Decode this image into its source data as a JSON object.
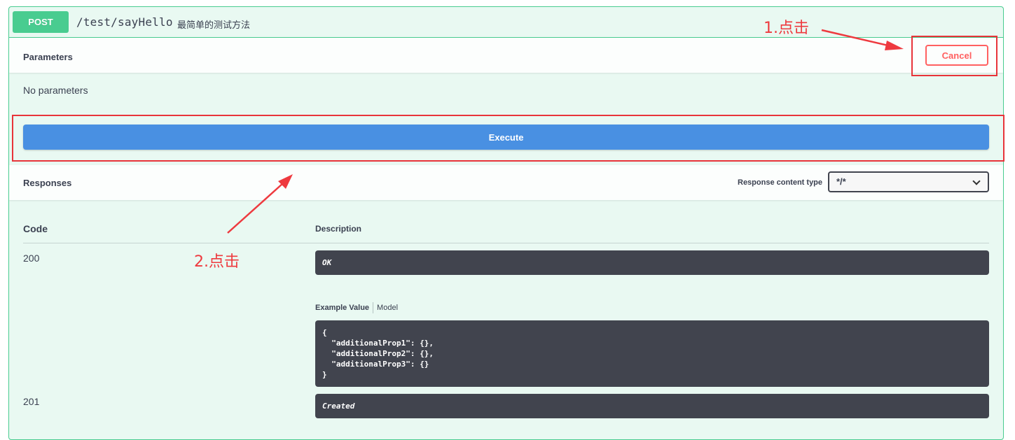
{
  "operation": {
    "method": "POST",
    "path": "/test/sayHello",
    "summary": "最简单的测试方法"
  },
  "parameters": {
    "title": "Parameters",
    "cancel_label": "Cancel",
    "empty_text": "No parameters"
  },
  "execute": {
    "label": "Execute"
  },
  "responses": {
    "title": "Responses",
    "content_type_label": "Response content type",
    "content_type_value": "*/*",
    "col_code": "Code",
    "col_description": "Description",
    "items": [
      {
        "code": "200",
        "description": "OK",
        "tabs": [
          "Example Value",
          "Model"
        ],
        "example": "{\n  \"additionalProp1\": {},\n  \"additionalProp2\": {},\n  \"additionalProp3\": {}\n}"
      },
      {
        "code": "201",
        "description": "Created"
      }
    ]
  },
  "annotations": {
    "step1": "1.点击",
    "step2": "2.点击"
  },
  "colors": {
    "post_green": "#49cc90",
    "execute_blue": "#4990e2",
    "cancel_red": "#ff6060",
    "annotation_red": "#e8343a",
    "dark_box": "#41444e"
  }
}
